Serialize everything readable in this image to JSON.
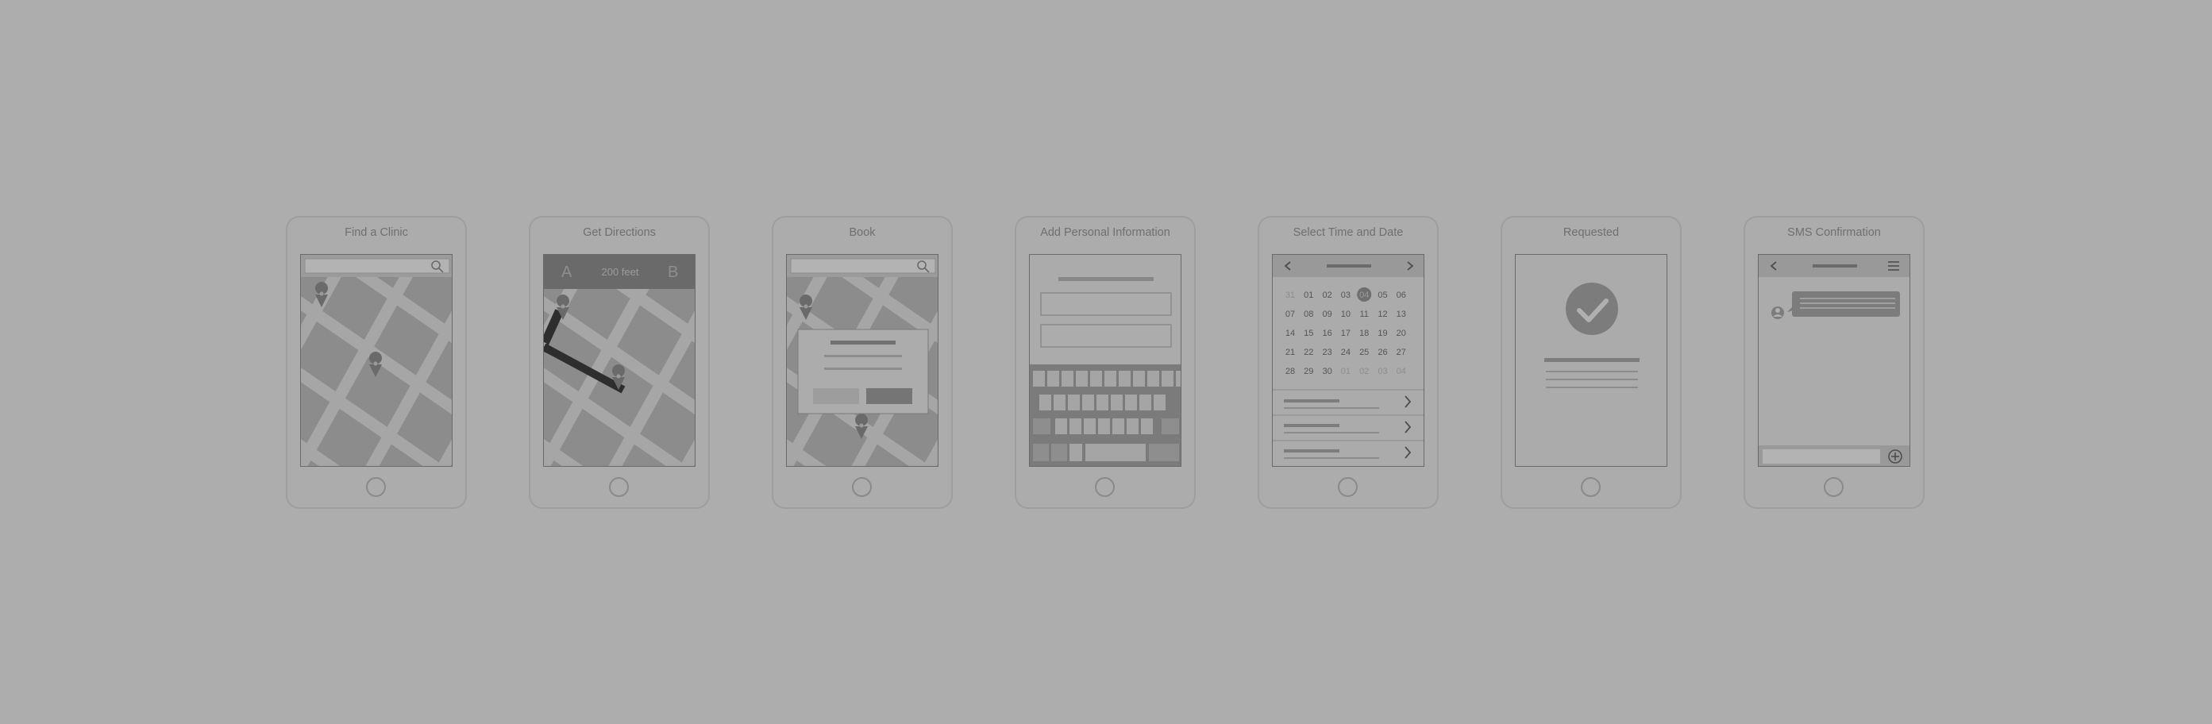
{
  "screens": [
    {
      "title": "Find a Clinic"
    },
    {
      "title": "Get Directions",
      "nav": {
        "start": "A",
        "distance": "200 feet",
        "end": "B"
      }
    },
    {
      "title": "Book"
    },
    {
      "title": "Add Personal Information"
    },
    {
      "title": "Select Time and Date"
    },
    {
      "title": "Requested"
    },
    {
      "title": "SMS Confirmation"
    }
  ],
  "calendar": {
    "rows": [
      [
        "31",
        "01",
        "02",
        "03",
        "04",
        "05",
        "06"
      ],
      [
        "07",
        "08",
        "09",
        "10",
        "11",
        "12",
        "13"
      ],
      [
        "14",
        "15",
        "16",
        "17",
        "18",
        "19",
        "20"
      ],
      [
        "21",
        "22",
        "23",
        "24",
        "25",
        "26",
        "27"
      ],
      [
        "28",
        "29",
        "30",
        "01",
        "02",
        "03",
        "04"
      ]
    ],
    "selected": "04"
  },
  "icons": [
    "search-icon",
    "map-pin-icon",
    "chevron-left-icon",
    "chevron-right-icon",
    "checkmark-icon",
    "avatar-icon",
    "menu-icon",
    "plus-circle-icon"
  ]
}
